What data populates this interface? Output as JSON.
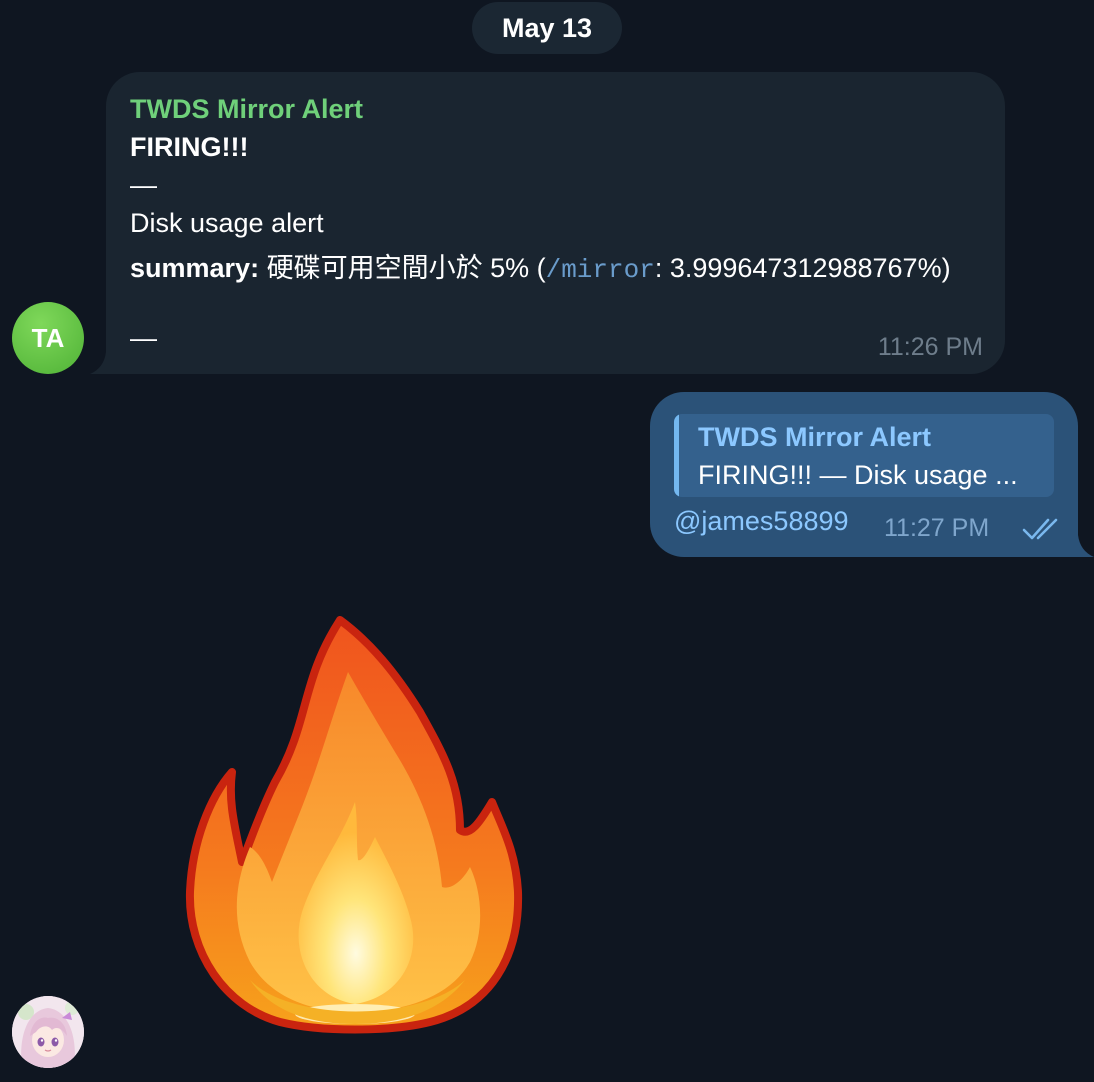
{
  "date_separator": "May 13",
  "incoming_message": {
    "avatar_initials": "TA",
    "sender": "TWDS Mirror Alert",
    "line1": "FIRING!!!",
    "dash1": "—",
    "line2": "Disk usage alert",
    "summary_label": "summary:",
    "summary_text": " 硬碟可用空間小於 5% (",
    "summary_path": "/mirror",
    "summary_value": ": 3.999647312988767%)",
    "dash2": "—",
    "time": "11:26 PM",
    "sender_color": "#6fd07a"
  },
  "outgoing_message": {
    "reply_to_sender": "TWDS Mirror Alert",
    "reply_preview": "FIRING!!! — Disk usage ...",
    "text": "@james58899",
    "time": "11:27 PM",
    "status_icon": "double-check-icon",
    "bubble_color": "#2b5278"
  },
  "sticker": {
    "icon": "fire-sticker"
  },
  "sticker_sender_avatar": {
    "icon": "anime-avatar"
  },
  "colors": {
    "background": "#0f1621",
    "incoming_bubble": "#1a2530",
    "link": "#8cc8ff"
  }
}
